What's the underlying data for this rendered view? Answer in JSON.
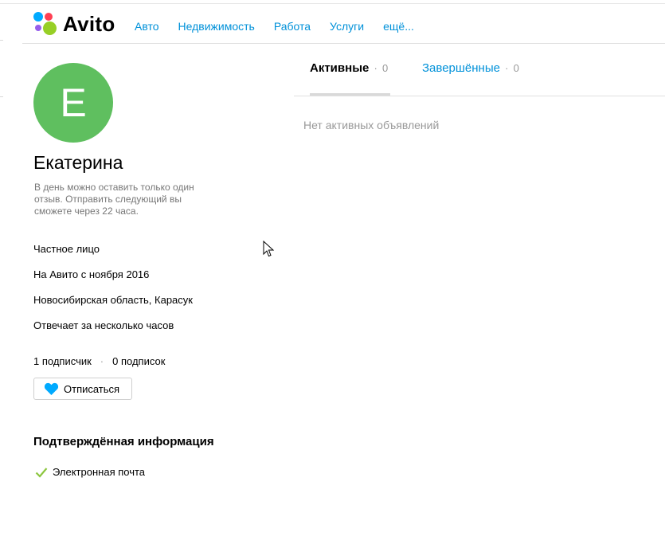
{
  "header": {
    "logo_text": "Avito",
    "logo_colors": [
      "#00aaff",
      "#ff4053",
      "#965eeb",
      "#97cf26"
    ],
    "nav": [
      "Авто",
      "Недвижимость",
      "Работа",
      "Услуги",
      "ещё..."
    ]
  },
  "profile": {
    "avatar_letter": "Е",
    "avatar_color": "#5fbf5f",
    "name": "Екатерина",
    "review_note": "В день можно оставить только один отзыв. Отправить следующий вы сможете через 22 часа.",
    "info": [
      "Частное лицо",
      "На Авито с ноября 2016",
      "Новосибирская область, Карасук",
      "Отвечает за несколько часов"
    ],
    "subscribers": "1 подписчик",
    "subscriptions": "0 подписок",
    "separator": "·",
    "unsubscribe_label": "Отписаться"
  },
  "verified": {
    "title": "Подтверждённая информация",
    "items": [
      "Электронная почта"
    ]
  },
  "tabs": {
    "active": {
      "label": "Активные",
      "count": "0"
    },
    "done": {
      "label": "Завершённые",
      "count": "0"
    },
    "separator": "·"
  },
  "empty_message": "Нет активных объявлений",
  "colors": {
    "link": "#0091d9",
    "muted": "#999999",
    "heart": "#00aaff",
    "check": "#8cc63f"
  }
}
